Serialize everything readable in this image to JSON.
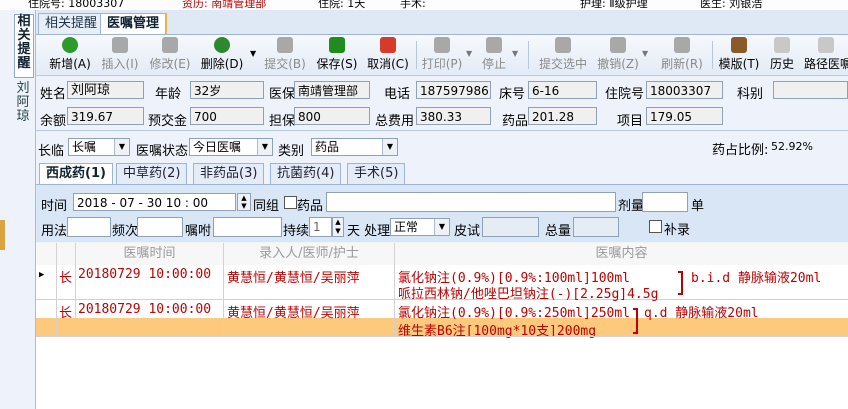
{
  "titlebar": {
    "left": "住院号: 18003307",
    "dept": "资历: 南靖管理部",
    "ward": "住院: 1天",
    "label": "手术:",
    "nursing": "护理: Ⅱ级护理",
    "doctor": "医生: 刘银浩"
  },
  "left_tabs": [
    "相关提醒",
    "刘阿琼"
  ],
  "top_tabs": [
    "相关提醒",
    "医嘱管理"
  ],
  "toolbar": [
    {
      "label": "新增(A)",
      "icon": "add-icon",
      "enabled": true
    },
    {
      "label": "插入(I)",
      "icon": "insert-icon",
      "enabled": false
    },
    {
      "label": "修改(E)",
      "icon": "edit-icon",
      "enabled": false
    },
    {
      "label": "删除(D)",
      "icon": "delete-icon",
      "enabled": true
    },
    {
      "label": "提交(B)",
      "icon": "submit-icon",
      "enabled": false
    },
    {
      "label": "保存(S)",
      "icon": "save-icon",
      "enabled": true
    },
    {
      "label": "取消(C)",
      "icon": "undo-icon",
      "enabled": true
    },
    {
      "label": "打印(P)",
      "icon": "print-icon",
      "enabled": false
    },
    {
      "label": "停止",
      "icon": "stop-icon",
      "enabled": false
    },
    {
      "label": "提交选中",
      "icon": "submit-selected-icon",
      "enabled": false
    },
    {
      "label": "撤销(Z)",
      "icon": "revoke-icon",
      "enabled": false
    },
    {
      "label": "刷新(R)",
      "icon": "refresh-icon",
      "enabled": false
    },
    {
      "label": "模版(T)",
      "icon": "template-icon",
      "enabled": true
    },
    {
      "label": "历史",
      "icon": "history-icon",
      "enabled": true
    },
    {
      "label": "路径医嘱",
      "icon": "pathway-icon",
      "enabled": true
    }
  ],
  "patient": {
    "name_label": "姓名",
    "name": "刘阿琼",
    "age_label": "年龄",
    "age": "32岁",
    "insurance_label": "医保",
    "insurance": "南靖管理部",
    "phone_label": "电话",
    "phone": "18759798612",
    "bed_label": "床号",
    "bed": "6-16",
    "admission_label": "住院号",
    "admission": "18003307",
    "dept_label": "科别",
    "dept": "",
    "balance_label": "余额",
    "balance": "319.67",
    "deposit_label": "预交金",
    "deposit": "700",
    "guarantee_label": "担保",
    "guarantee": "800",
    "total_label": "总费用",
    "total": "380.33",
    "drug_label": "药品",
    "drug": "201.28",
    "item_label": "项目",
    "item": "179.05"
  },
  "filters": {
    "long_label": "长临",
    "long_value": "长嘱",
    "status_label": "医嘱状态",
    "status_value": "今日医嘱",
    "category_label": "类别",
    "category_value": "药品",
    "ratio_label": "药占比例:",
    "ratio_value": "52.92%"
  },
  "sub_tabs": [
    "西成药(1)",
    "中草药(2)",
    "非药品(3)",
    "抗菌药(4)",
    "手术(5)"
  ],
  "entry": {
    "time_label": "时间",
    "time_value": "2018 - 07 - 30   10 : 00",
    "group_label": "同组",
    "drug_check_label": "药品",
    "dose_label": "剂量",
    "unit_label": "单",
    "usage_label": "用法",
    "freq_label": "频次",
    "note_label": "嘱咐",
    "continue_label": "持续",
    "continue_value": "1",
    "day_label": "天 处理",
    "process_value": "正常",
    "skin_label": "皮试",
    "total_label": "总量",
    "supplement_label": "补录"
  },
  "grid": {
    "headers": [
      "医嘱时间",
      "录入人/医师/护士",
      "医嘱内容"
    ],
    "rows": [
      {
        "type": "长",
        "time": "20180729 10:00:00",
        "staff": "黄慧恒/黄慧恒/吴丽萍",
        "line1": "氯化钠注(0.9%)[0.9%:100ml]100ml",
        "line2": "哌拉西林钠/他唑巴坦钠注(-)[2.25g]4.5g",
        "usage": "b.i.d 静脉输液20ml"
      },
      {
        "type": "长",
        "time": "20180729 10:00:00",
        "staff": "黄慧恒/黄慧恒/吴丽萍",
        "line1": "氯化钠注(0.9%)[0.9%:250ml]250ml",
        "line2": "维生素B6注[100mg*10支]200mg",
        "usage": "q.d 静脉输液20ml"
      }
    ]
  },
  "colors": {
    "accent": "#c00000",
    "selected_row": "#fcc97d"
  }
}
